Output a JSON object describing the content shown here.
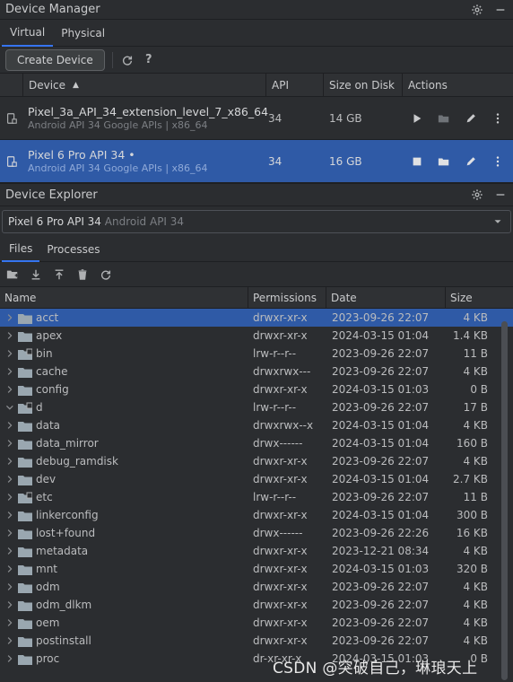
{
  "device_manager": {
    "title": "Device Manager",
    "tabs": [
      "Virtual",
      "Physical"
    ],
    "create_button": "Create Device",
    "columns": {
      "device": "Device",
      "api": "API",
      "size": "Size on Disk",
      "actions": "Actions"
    },
    "devices": [
      {
        "name": "Pixel_3a_API_34_extension_level_7_x86_64",
        "sub": "Android API 34 Google APIs | x86_64",
        "api": "34",
        "size": "14 GB",
        "running": false
      },
      {
        "name": "Pixel 6 Pro API 34 •",
        "sub": "Android API 34 Google APIs | x86_64",
        "api": "34",
        "size": "16 GB",
        "running": true
      }
    ]
  },
  "device_explorer": {
    "title": "Device Explorer",
    "selected_device": "Pixel 6 Pro API 34",
    "selected_device_sub": "Android API 34",
    "tabs": [
      "Files",
      "Processes"
    ],
    "columns": {
      "name": "Name",
      "permissions": "Permissions",
      "date": "Date",
      "size": "Size"
    },
    "files": [
      {
        "name": "acct",
        "perm": "drwxr-xr-x",
        "date": "2023-09-26 22:07",
        "size": "4 KB",
        "type": "folder",
        "expanded": false
      },
      {
        "name": "apex",
        "perm": "drwxr-xr-x",
        "date": "2024-03-15 01:04",
        "size": "1.4 KB",
        "type": "folder",
        "expanded": false
      },
      {
        "name": "bin",
        "perm": "lrw-r--r--",
        "date": "2023-09-26 22:07",
        "size": "11 B",
        "type": "link",
        "expanded": false
      },
      {
        "name": "cache",
        "perm": "drwxrwx---",
        "date": "2023-09-26 22:07",
        "size": "4 KB",
        "type": "folder",
        "expanded": false
      },
      {
        "name": "config",
        "perm": "drwxr-xr-x",
        "date": "2024-03-15 01:03",
        "size": "0 B",
        "type": "folder",
        "expanded": false
      },
      {
        "name": "d",
        "perm": "lrw-r--r--",
        "date": "2023-09-26 22:07",
        "size": "17 B",
        "type": "link",
        "expanded": true
      },
      {
        "name": "data",
        "perm": "drwxrwx--x",
        "date": "2024-03-15 01:04",
        "size": "4 KB",
        "type": "folder",
        "expanded": false
      },
      {
        "name": "data_mirror",
        "perm": "drwx------",
        "date": "2024-03-15 01:04",
        "size": "160 B",
        "type": "folder",
        "expanded": false
      },
      {
        "name": "debug_ramdisk",
        "perm": "drwxr-xr-x",
        "date": "2023-09-26 22:07",
        "size": "4 KB",
        "type": "folder",
        "expanded": false
      },
      {
        "name": "dev",
        "perm": "drwxr-xr-x",
        "date": "2024-03-15 01:04",
        "size": "2.7 KB",
        "type": "folder",
        "expanded": false
      },
      {
        "name": "etc",
        "perm": "lrw-r--r--",
        "date": "2023-09-26 22:07",
        "size": "11 B",
        "type": "link",
        "expanded": false
      },
      {
        "name": "linkerconfig",
        "perm": "drwxr-xr-x",
        "date": "2024-03-15 01:04",
        "size": "300 B",
        "type": "folder",
        "expanded": false
      },
      {
        "name": "lost+found",
        "perm": "drwx------",
        "date": "2023-09-26 22:26",
        "size": "16 KB",
        "type": "folder",
        "expanded": false
      },
      {
        "name": "metadata",
        "perm": "drwxr-xr-x",
        "date": "2023-12-21 08:34",
        "size": "4 KB",
        "type": "folder",
        "expanded": false
      },
      {
        "name": "mnt",
        "perm": "drwxr-xr-x",
        "date": "2024-03-15 01:03",
        "size": "320 B",
        "type": "folder",
        "expanded": false
      },
      {
        "name": "odm",
        "perm": "drwxr-xr-x",
        "date": "2023-09-26 22:07",
        "size": "4 KB",
        "type": "folder",
        "expanded": false
      },
      {
        "name": "odm_dlkm",
        "perm": "drwxr-xr-x",
        "date": "2023-09-26 22:07",
        "size": "4 KB",
        "type": "folder",
        "expanded": false
      },
      {
        "name": "oem",
        "perm": "drwxr-xr-x",
        "date": "2023-09-26 22:07",
        "size": "4 KB",
        "type": "folder",
        "expanded": false
      },
      {
        "name": "postinstall",
        "perm": "drwxr-xr-x",
        "date": "2023-09-26 22:07",
        "size": "4 KB",
        "type": "folder",
        "expanded": false
      },
      {
        "name": "proc",
        "perm": "dr-xr-xr-x",
        "date": "2024-03-15 01:03",
        "size": "0 B",
        "type": "folder",
        "expanded": false
      }
    ]
  },
  "watermark": "CSDN @突破自己，琳琅天上",
  "colors": {
    "background": "#2b2d30",
    "selection": "#2f5aa6",
    "accent": "#3574f0",
    "folder": "#9aa7b0"
  }
}
